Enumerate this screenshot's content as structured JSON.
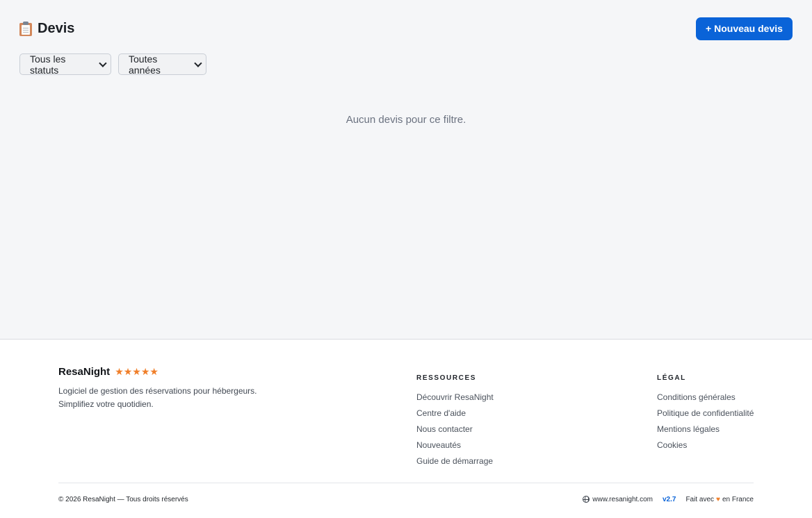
{
  "header": {
    "title": "Devis",
    "title_icon": "clipboard-icon",
    "new_button_label": "+ Nouveau devis",
    "accent_color": "#0a63d8"
  },
  "filters": {
    "status_selected": "Tous les statuts",
    "year_selected": "Toutes années"
  },
  "main": {
    "empty_message": "Aucun devis pour ce filtre."
  },
  "footer": {
    "brand_name": "ResaNight",
    "rating_stars": 5,
    "stars_text": "★★★★★",
    "tagline_line1": "Logiciel de gestion des réservations pour hébergeurs.",
    "tagline_line2": "Simplifiez votre quotidien.",
    "resources": {
      "title": "RESSOURCES",
      "links": [
        "Découvrir ResaNight",
        "Centre d'aide",
        "Nous contacter",
        "Nouveautés",
        "Guide de démarrage"
      ]
    },
    "legal": {
      "title": "LÉGAL",
      "links": [
        "Conditions générales",
        "Politique de confidentialité",
        "Mentions légales",
        "Cookies"
      ]
    },
    "copyright": "© 2026 ResaNight — Tous droits réservés",
    "website": "www.resanight.com",
    "version": "v2.7",
    "made_prefix": "Fait avec",
    "made_heart": "♥",
    "made_suffix": "en France"
  }
}
